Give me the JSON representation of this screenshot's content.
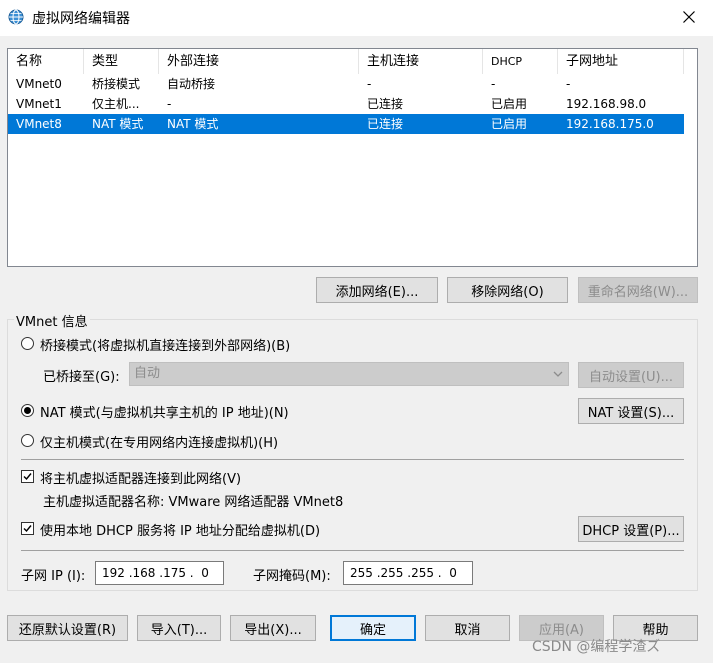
{
  "window": {
    "title": "虚拟网络编辑器"
  },
  "icons": {
    "app": "network-globe-icon",
    "close": "close-icon",
    "dropdown": "chevron-down-icon"
  },
  "colors": {
    "selection": "#0078d7",
    "default_border": "#0078d7"
  },
  "network_list": {
    "columns": [
      "名称",
      "类型",
      "外部连接",
      "主机连接",
      "DHCP",
      "子网地址"
    ],
    "rows": [
      {
        "name": "VMnet0",
        "type": "桥接模式",
        "external": "自动桥接",
        "host": "-",
        "dhcp": "-",
        "subnet": "-",
        "selected": false
      },
      {
        "name": "VMnet1",
        "type": "仅主机...",
        "external": "-",
        "host": "已连接",
        "dhcp": "已启用",
        "subnet": "192.168.98.0",
        "selected": false
      },
      {
        "name": "VMnet8",
        "type": "NAT 模式",
        "external": "NAT 模式",
        "host": "已连接",
        "dhcp": "已启用",
        "subnet": "192.168.175.0",
        "selected": true
      }
    ]
  },
  "list_buttons": {
    "add": "添加网络(E)...",
    "remove": "移除网络(O)",
    "rename": "重命名网络(W)..."
  },
  "vmnet_info": {
    "legend": "VMnet 信息",
    "bridged_label": "桥接模式(将虚拟机直接连接到外部网络)(B)",
    "bridged_to_label": "已桥接至(G):",
    "bridged_to_value": "自动",
    "auto_settings": "自动设置(U)...",
    "nat_label": "NAT 模式(与虚拟机共享主机的 IP 地址)(N)",
    "nat_settings": "NAT 设置(S)...",
    "hostonly_label": "仅主机模式(在专用网络内连接虚拟机)(H)",
    "selected_mode": "nat",
    "connect_adapter_label": "将主机虚拟适配器连接到此网络(V)",
    "connect_adapter_checked": true,
    "adapter_name_label": "主机虚拟适配器名称: VMware 网络适配器 VMnet8",
    "dhcp_label": "使用本地 DHCP 服务将 IP 地址分配给虚拟机(D)",
    "dhcp_checked": true,
    "dhcp_settings": "DHCP 设置(P)...",
    "subnet_ip_label": "子网 IP (I):",
    "subnet_ip_value": "192 .168 .175 .  0",
    "subnet_mask_label": "子网掩码(M):",
    "subnet_mask_value": "255 .255 .255 .  0"
  },
  "footer": {
    "restore": "还原默认设置(R)",
    "import": "导入(T)...",
    "export": "导出(X)...",
    "ok": "确定",
    "cancel": "取消",
    "apply": "应用(A)",
    "help": "帮助"
  },
  "watermark": "CSDN @编程学渣ズ"
}
